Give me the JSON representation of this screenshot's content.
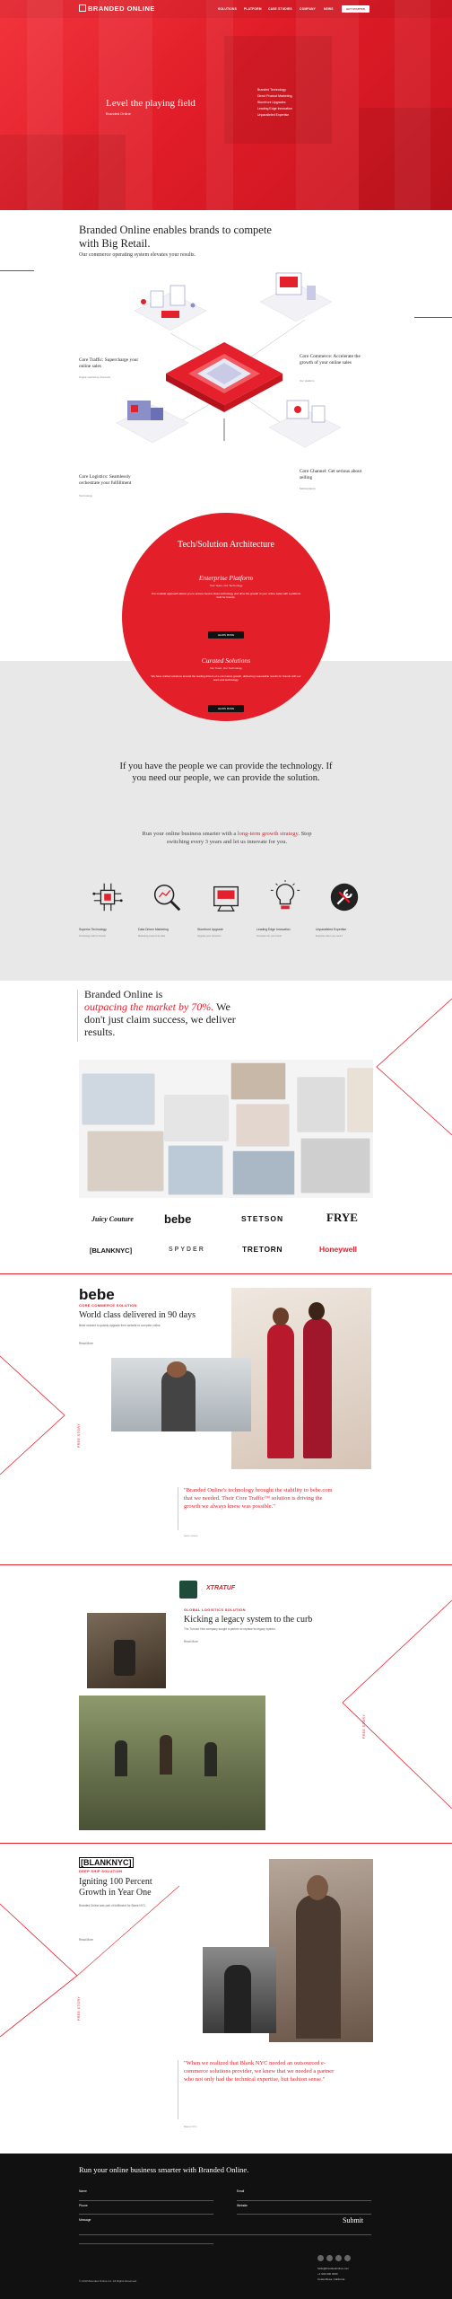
{
  "header": {
    "logo": "BRANDED ONLINE",
    "nav": [
      "SOLUTIONS",
      "PLATFORM",
      "CASE STUDIES",
      "COMPANY",
      "NEWS"
    ],
    "cta": "GET STARTED"
  },
  "hero": {
    "title": "Level the playing field",
    "subtitle": "Branded Online",
    "list": [
      "Branded Technology",
      "Direct Product Marketing",
      "Storefront Upgrades",
      "Leading Edge Innovation",
      "Unparalleled Expertise"
    ]
  },
  "intro": {
    "title": "Branded Online enables brands to compete with Big Retail.",
    "subtitle": "Our commerce operating system elevates your results."
  },
  "diagram": {
    "labels": [
      {
        "title": "Core Traffic: Supercharge your online sales",
        "text": "Digital marketing channels"
      },
      {
        "title": "Core Commerce: Accelerate the growth of your online sales",
        "text": "Our platform"
      },
      {
        "title": "Core Logistics: Seamlessly orchestrate your fulfillment",
        "text": "Technology"
      },
      {
        "title": "Core Channel: Get serious about selling",
        "text": "Marketplaces"
      }
    ]
  },
  "arch": {
    "title": "Tech/Solution Architecture",
    "blocks": [
      {
        "heading": "Enterprise Platform",
        "sub": "Your Team, Our Technology",
        "text": "Our modular approach allows you to access best-in-class technology and drive the growth of your online sales with a platform built for brands.",
        "button": "LEARN MORE"
      },
      {
        "heading": "Curated Solutions",
        "sub": "Our Team, Our Technology",
        "text": "We have crafted solutions around the leading drivers of e-commerce growth, delivering measurable results for brands with our team and technology.",
        "button": "LEARN MORE"
      }
    ]
  },
  "people": {
    "title": "If you have the people we can provide the technology. If you need our people, we can provide the solution."
  },
  "runbiz": {
    "before": "Run your online business smarter with a ",
    "highlight": "long-term growth strategy",
    "after": ". Stop switching every 3 years and let us innovate for you."
  },
  "features": [
    {
      "icon": "circuit-icon",
      "title": "Superior Technology",
      "text": "Technology built for brands"
    },
    {
      "icon": "magnifier-icon",
      "title": "Data Driven Marketing",
      "text": "Marketing powered by data"
    },
    {
      "icon": "storefront-icon",
      "title": "Storefront Upgrade",
      "text": "Upgrade your storefront"
    },
    {
      "icon": "lightbulb-icon",
      "title": "Leading Edge Innovation",
      "text": "Innovation for your brand"
    },
    {
      "icon": "tools-icon",
      "title": "Unparalleled Expertise",
      "text": "Expertise when you need it"
    }
  ],
  "outpace": {
    "line1": "Branded Online is",
    "highlight": "outpacing the market by 70%.",
    "line2": " We don't just claim success, we deliver results."
  },
  "brands": [
    "Juicy Couture",
    "bebe",
    "STETSON",
    "FRYE",
    "[BLANKNYC]",
    "SPYDER",
    "TRETORN",
    "Honeywell"
  ],
  "cases": [
    {
      "logo": "bebe",
      "tag": "CORE COMMERCE SOLUTION",
      "title": "World class delivered in 90 days",
      "text": "Bebe needed to quickly upgrade their website to compete online.",
      "link": "Read More",
      "vertical": "FREE STORY",
      "quote": "\"Branded Online's technology brought the stability to bebe.com that we needed. Their Core Traffic™ solution is driving the growth we always knew was possible.\"",
      "by": "bebe stores"
    },
    {
      "logo": "XTRATUF",
      "tag": "GLOBAL LOGISTICS SOLUTION",
      "title": "Kicking a legacy system to the curb",
      "text": "The Turnout Hub company sought a partner to replace its legacy system.",
      "link": "Read More",
      "vertical": "FREE STORY"
    },
    {
      "logo": "[BLANKNYC]",
      "tag": "DEEP SHIP SOLUTION",
      "title": "Igniting 100 Percent Growth in Year One",
      "text": "Branded Online was part of fulfillment for Blank NYC.",
      "link": "Read More",
      "vertical": "FREE STORY",
      "quote": "\"When we realized that Blank NYC needed an outsourced e-commerce solutions provider, we knew that we needed a partner who not only had the technical expertise, but fashion sense.\"",
      "by": "Blank NYC"
    }
  ],
  "footer": {
    "title": "Run your online business smarter with Branded Online.",
    "fields": [
      "Name",
      "Email",
      "Phone",
      "Website",
      "Message"
    ],
    "submit": "Submit",
    "copyright": "© 2019 Branded Online Inc. All Rights Reserved.",
    "address": [
      "hello@brandedonline.com",
      "+1 949 000 0000",
      "Costa Mesa, California"
    ]
  },
  "colors": {
    "accent": "#e4202c",
    "footer": "#111111",
    "band": "#e8e8e8"
  }
}
